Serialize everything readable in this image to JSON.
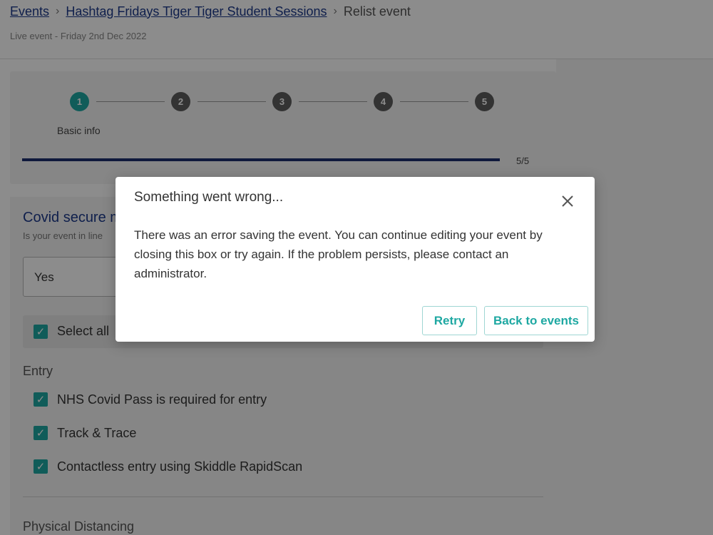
{
  "breadcrumb": {
    "events": "Events",
    "event_name": "Hashtag Fridays Tiger Tiger Student Sessions",
    "current": "Relist event",
    "separator": "›"
  },
  "subline": "Live event - Friday 2nd Dec 2022",
  "stepper": {
    "steps": [
      "1",
      "2",
      "3",
      "4",
      "5"
    ],
    "active_step": 1,
    "active_label": "Basic info",
    "progress_text": "5/5",
    "progress_fraction": 1.0,
    "colors": {
      "active": "#1ea8a2",
      "inactive": "#5d5d5d",
      "progress": "#1d2f6e"
    }
  },
  "form": {
    "section_title": "Covid secure m",
    "section_subtitle": "Is your event in line",
    "select_value": "Yes",
    "select_all_label": "Select all",
    "entry_title": "Entry",
    "entry_items": [
      "NHS Covid Pass is required for entry",
      "Track & Trace",
      "Contactless entry using Skiddle RapidScan"
    ],
    "distancing_title": "Physical Distancing",
    "check_glyph": "✓"
  },
  "modal": {
    "title": "Something went wrong...",
    "body": "There was an error saving the event. You can continue editing your event by closing this box or try again. If the problem persists, please contact an administrator.",
    "retry_label": "Retry",
    "back_label": "Back to events",
    "accent": "#1ea8a2"
  }
}
